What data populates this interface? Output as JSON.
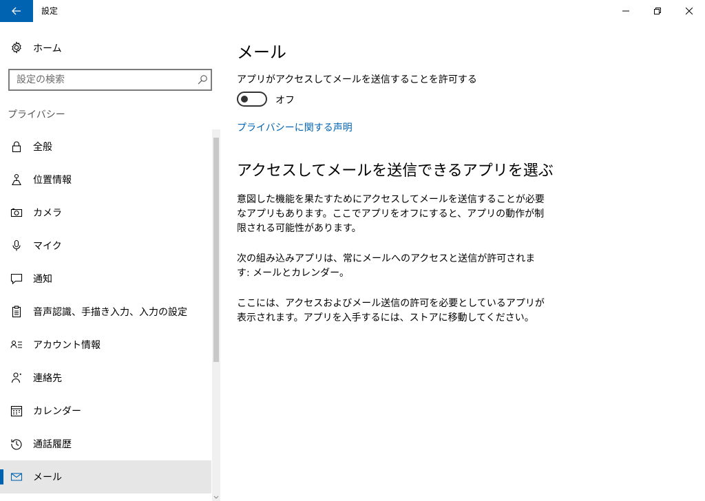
{
  "window": {
    "title": "設定",
    "back_icon": "back-arrow-icon",
    "controls": [
      "minimize-icon",
      "restore-icon",
      "close-icon"
    ]
  },
  "sidebar": {
    "home": {
      "label": "ホーム",
      "icon": "gear-icon"
    },
    "search": {
      "placeholder": "設定の検索",
      "value": "",
      "icon": "search-icon"
    },
    "section_label": "プライバシー",
    "items": [
      {
        "label": "全般",
        "icon": "lock-icon",
        "selected": false
      },
      {
        "label": "位置情報",
        "icon": "location-icon",
        "selected": false
      },
      {
        "label": "カメラ",
        "icon": "camera-icon",
        "selected": false
      },
      {
        "label": "マイク",
        "icon": "microphone-icon",
        "selected": false
      },
      {
        "label": "通知",
        "icon": "notification-icon",
        "selected": false
      },
      {
        "label": "音声認識、手描き入力、入力の設定",
        "icon": "clipboard-icon",
        "selected": false
      },
      {
        "label": "アカウント情報",
        "icon": "account-info-icon",
        "selected": false
      },
      {
        "label": "連絡先",
        "icon": "contacts-icon",
        "selected": false
      },
      {
        "label": "カレンダー",
        "icon": "calendar-icon",
        "selected": false
      },
      {
        "label": "通話履歴",
        "icon": "history-icon",
        "selected": false
      },
      {
        "label": "メール",
        "icon": "mail-icon",
        "selected": true
      }
    ]
  },
  "main": {
    "title": "メール",
    "toggle_label": "アプリがアクセスしてメールを送信することを許可する",
    "toggle_state": "オフ",
    "privacy_link": "プライバシーに関する声明",
    "subtitle": "アクセスしてメールを送信できるアプリを選ぶ",
    "paragraphs": [
      "意図した機能を果たすためにアクセスしてメールを送信することが必要なアプリもあります。ここでアプリをオフにすると、アプリの動作が制限される可能性があります。",
      "次の組み込みアプリは、常にメールへのアクセスと送信が許可されます: メールとカレンダー。",
      "ここには、アクセスおよびメール送信の許可を必要としているアプリが表示されます。アプリを入手するには、ストアに移動してください。"
    ]
  },
  "colors": {
    "accent": "#0063b1",
    "selected_bg": "#e6e6e6"
  }
}
